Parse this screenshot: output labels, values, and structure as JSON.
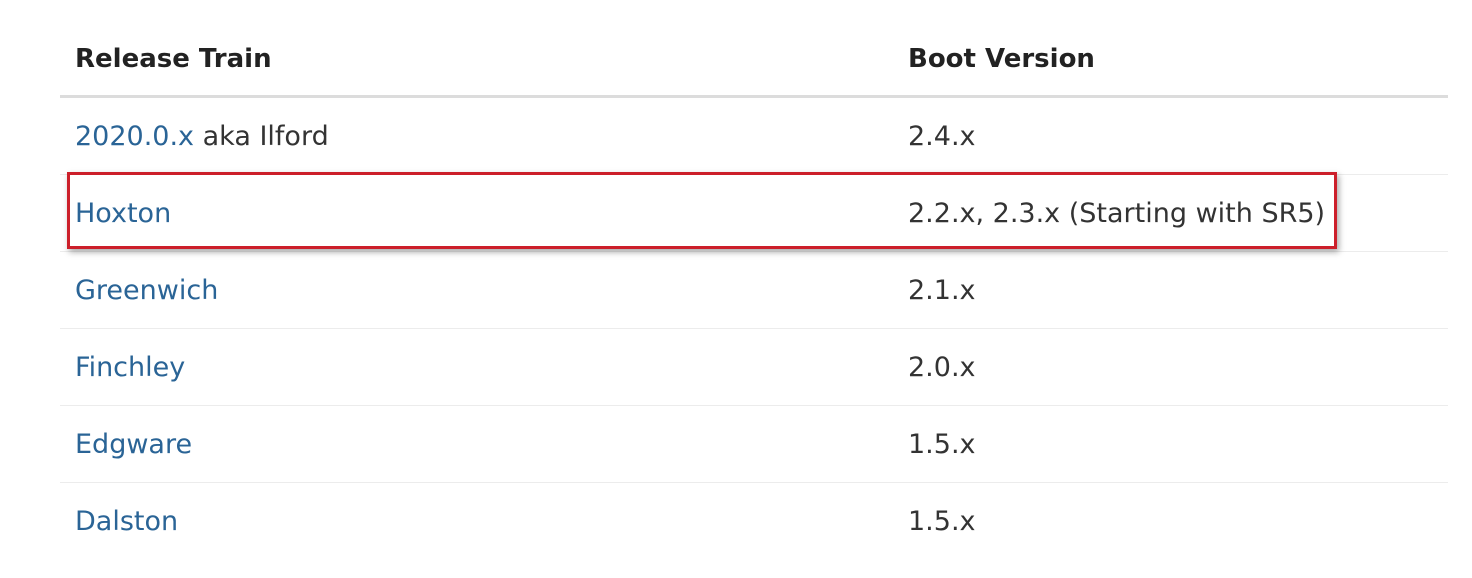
{
  "table": {
    "headers": {
      "release_train": "Release Train",
      "boot_version": "Boot Version"
    },
    "rows": [
      {
        "train_link": "2020.0.x",
        "train_suffix": " aka Ilford",
        "boot": "2.4.x"
      },
      {
        "train_link": "Hoxton",
        "train_suffix": "",
        "boot": "2.2.x, 2.3.x (Starting with SR5)"
      },
      {
        "train_link": "Greenwich",
        "train_suffix": "",
        "boot": "2.1.x"
      },
      {
        "train_link": "Finchley",
        "train_suffix": "",
        "boot": "2.0.x"
      },
      {
        "train_link": "Edgware",
        "train_suffix": "",
        "boot": "1.5.x"
      },
      {
        "train_link": "Dalston",
        "train_suffix": "",
        "boot": "1.5.x"
      }
    ]
  },
  "colors": {
    "link": "#2a6496",
    "highlight_border": "#cc1f2a"
  }
}
